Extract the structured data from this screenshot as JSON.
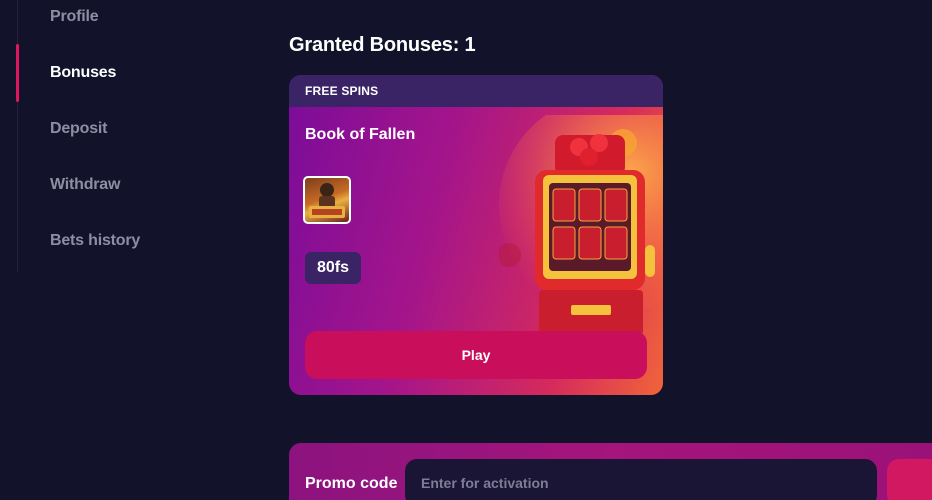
{
  "sidebar": {
    "items": [
      {
        "label": "Profile"
      },
      {
        "label": "Bonuses"
      },
      {
        "label": "Deposit"
      },
      {
        "label": "Withdraw"
      },
      {
        "label": "Bets history"
      }
    ]
  },
  "main": {
    "title": "Granted Bonuses: 1"
  },
  "bonus_card": {
    "type_label": "FREE SPINS",
    "game_name": "Book of Fallen",
    "amount": "80fs",
    "play_label": "Play"
  },
  "promo": {
    "label": "Promo code",
    "placeholder": "Enter for activation"
  },
  "colors": {
    "background": "#12122a",
    "accent": "#c90f5c",
    "header": "#3a2466"
  }
}
